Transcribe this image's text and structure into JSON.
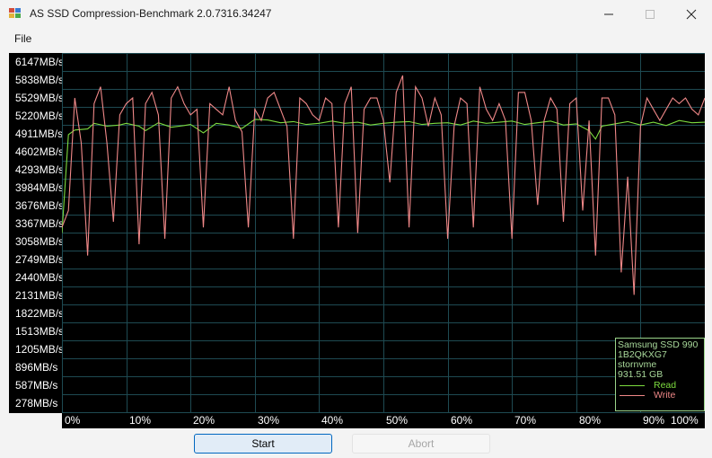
{
  "window": {
    "title": "AS SSD Compression-Benchmark 2.0.7316.34247"
  },
  "menu": {
    "file": "File"
  },
  "chart_data": {
    "type": "line",
    "y_tick_labels": [
      "6147MB/s",
      "5838MB/s",
      "5529MB/s",
      "5220MB/s",
      "4911MB/s",
      "4602MB/s",
      "4293MB/s",
      "3984MB/s",
      "3676MB/s",
      "3367MB/s",
      "3058MB/s",
      "2749MB/s",
      "2440MB/s",
      "2131MB/s",
      "1822MB/s",
      "1513MB/s",
      "1205MB/s",
      "896MB/s",
      "587MB/s",
      "278MB/s"
    ],
    "x_tick_labels": [
      "0%",
      "10%",
      "20%",
      "30%",
      "40%",
      "50%",
      "60%",
      "70%",
      "80%",
      "90%",
      "100%"
    ],
    "xlim": [
      0,
      100
    ],
    "ylim": [
      0,
      6400
    ],
    "grid": true,
    "legend_position": "bottom-right",
    "series": [
      {
        "name": "Read",
        "color": "#7ddc3f",
        "x": [
          0,
          1,
          2,
          4,
          5,
          7,
          9,
          10,
          12,
          13,
          15,
          17,
          19,
          20,
          22,
          24,
          26,
          28,
          30,
          32,
          34,
          36,
          38,
          40,
          42,
          44,
          46,
          48,
          50,
          52,
          54,
          56,
          58,
          60,
          62,
          64,
          66,
          68,
          70,
          72,
          74,
          76,
          78,
          80,
          82,
          83,
          84,
          86,
          88,
          90,
          92,
          94,
          96,
          98,
          100
        ],
        "y": [
          3200,
          4950,
          5030,
          5050,
          5150,
          5100,
          5120,
          5150,
          5100,
          5020,
          5160,
          5080,
          5110,
          5130,
          4980,
          5150,
          5120,
          5060,
          5220,
          5210,
          5160,
          5180,
          5130,
          5150,
          5190,
          5150,
          5170,
          5120,
          5150,
          5170,
          5180,
          5130,
          5150,
          5160,
          5120,
          5190,
          5150,
          5170,
          5190,
          5130,
          5160,
          5190,
          5120,
          5140,
          5020,
          4870,
          5100,
          5140,
          5180,
          5120,
          5170,
          5110,
          5200,
          5160,
          5170
        ]
      },
      {
        "name": "Write",
        "color": "#f08888",
        "x": [
          0,
          1,
          2,
          3,
          4,
          5,
          6,
          7,
          8,
          9,
          10,
          11,
          12,
          13,
          14,
          15,
          16,
          17,
          18,
          19,
          20,
          21,
          22,
          23,
          24,
          25,
          26,
          27,
          28,
          29,
          30,
          31,
          32,
          33,
          34,
          35,
          36,
          37,
          38,
          39,
          40,
          41,
          42,
          43,
          44,
          45,
          46,
          47,
          48,
          49,
          50,
          51,
          52,
          53,
          54,
          55,
          56,
          57,
          58,
          59,
          60,
          61,
          62,
          63,
          64,
          65,
          66,
          67,
          68,
          69,
          70,
          71,
          72,
          73,
          74,
          75,
          76,
          77,
          78,
          79,
          80,
          81,
          82,
          83,
          84,
          85,
          86,
          87,
          88,
          89,
          90,
          91,
          92,
          93,
          94,
          95,
          96,
          97,
          98,
          99,
          100
        ],
        "y": [
          3300,
          3600,
          5600,
          4800,
          2800,
          5500,
          5800,
          4800,
          3400,
          5300,
          5500,
          5600,
          3000,
          5500,
          5700,
          5300,
          3100,
          5600,
          5800,
          5500,
          5300,
          5400,
          3300,
          5500,
          5400,
          5300,
          5800,
          5200,
          5000,
          3300,
          5400,
          5200,
          5600,
          5700,
          5400,
          5100,
          3100,
          5600,
          5500,
          5300,
          5200,
          5600,
          5500,
          3300,
          5500,
          5800,
          3200,
          5400,
          5600,
          5600,
          5200,
          4100,
          5700,
          6000,
          3300,
          5800,
          5600,
          5100,
          5600,
          5300,
          3100,
          5100,
          5600,
          5500,
          3300,
          5800,
          5400,
          5200,
          5500,
          5200,
          3100,
          5700,
          5700,
          5200,
          3700,
          5200,
          5600,
          5400,
          3400,
          5500,
          5600,
          3600,
          5200,
          2800,
          5600,
          5600,
          5300,
          2500,
          4200,
          2100,
          5100,
          5600,
          5400,
          5200,
          5400,
          5600,
          5500,
          5600,
          5400,
          5300,
          5600
        ]
      }
    ]
  },
  "legend": {
    "drive": "Samsung SSD 990",
    "serial": "1B2QKXG7",
    "driver": "stornvme",
    "capacity": "931.51 GB",
    "read_label": "Read",
    "write_label": "Write"
  },
  "buttons": {
    "start": "Start",
    "abort": "Abort"
  },
  "colors": {
    "grid": "#1e4a52",
    "background": "#000000",
    "read": "#7ddc3f",
    "write": "#f08888",
    "accent": "#0067c0"
  }
}
